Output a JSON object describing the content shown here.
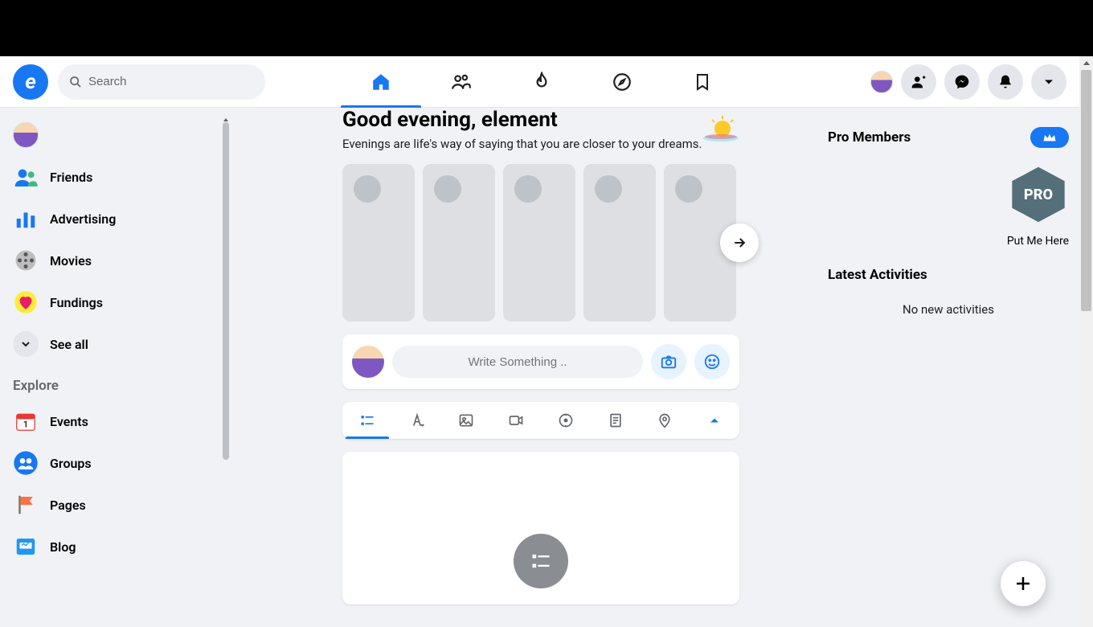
{
  "search": {
    "placeholder": "Search"
  },
  "greeting": {
    "title": "Good evening, element",
    "subtitle": "Evenings are life's way of saying that you are closer to your dreams."
  },
  "sidebar": {
    "items": [
      {
        "label": ""
      },
      {
        "label": "Friends"
      },
      {
        "label": "Advertising"
      },
      {
        "label": "Movies"
      },
      {
        "label": "Fundings"
      }
    ],
    "see_all": "See all",
    "explore_heading": "Explore",
    "explore": [
      {
        "label": "Events"
      },
      {
        "label": "Groups"
      },
      {
        "label": "Pages"
      },
      {
        "label": "Blog"
      }
    ]
  },
  "composer": {
    "placeholder": "Write Something .."
  },
  "right": {
    "pro_members": "Pro Members",
    "put_me": "Put Me Here",
    "latest": "Latest Activities",
    "no_activities": "No new activities"
  }
}
